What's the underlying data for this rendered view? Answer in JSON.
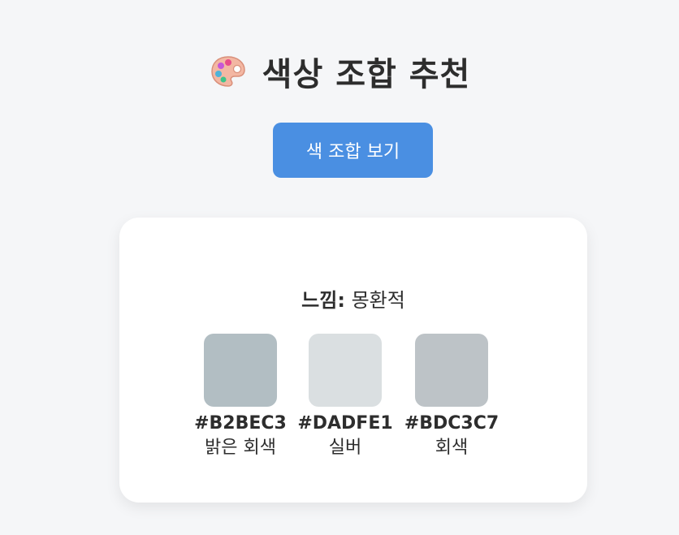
{
  "header": {
    "icon": "palette-icon",
    "title": "색상 조합 추천"
  },
  "button": {
    "label": "색 조합 보기",
    "color": "#4a8fe2"
  },
  "result": {
    "mood_label": "느낌:",
    "mood_value": "몽환적",
    "colors": [
      {
        "hex": "#B2BEC3",
        "name": "밝은 회색"
      },
      {
        "hex": "#DADFE1",
        "name": "실버"
      },
      {
        "hex": "#BDC3C7",
        "name": "회색"
      }
    ]
  }
}
